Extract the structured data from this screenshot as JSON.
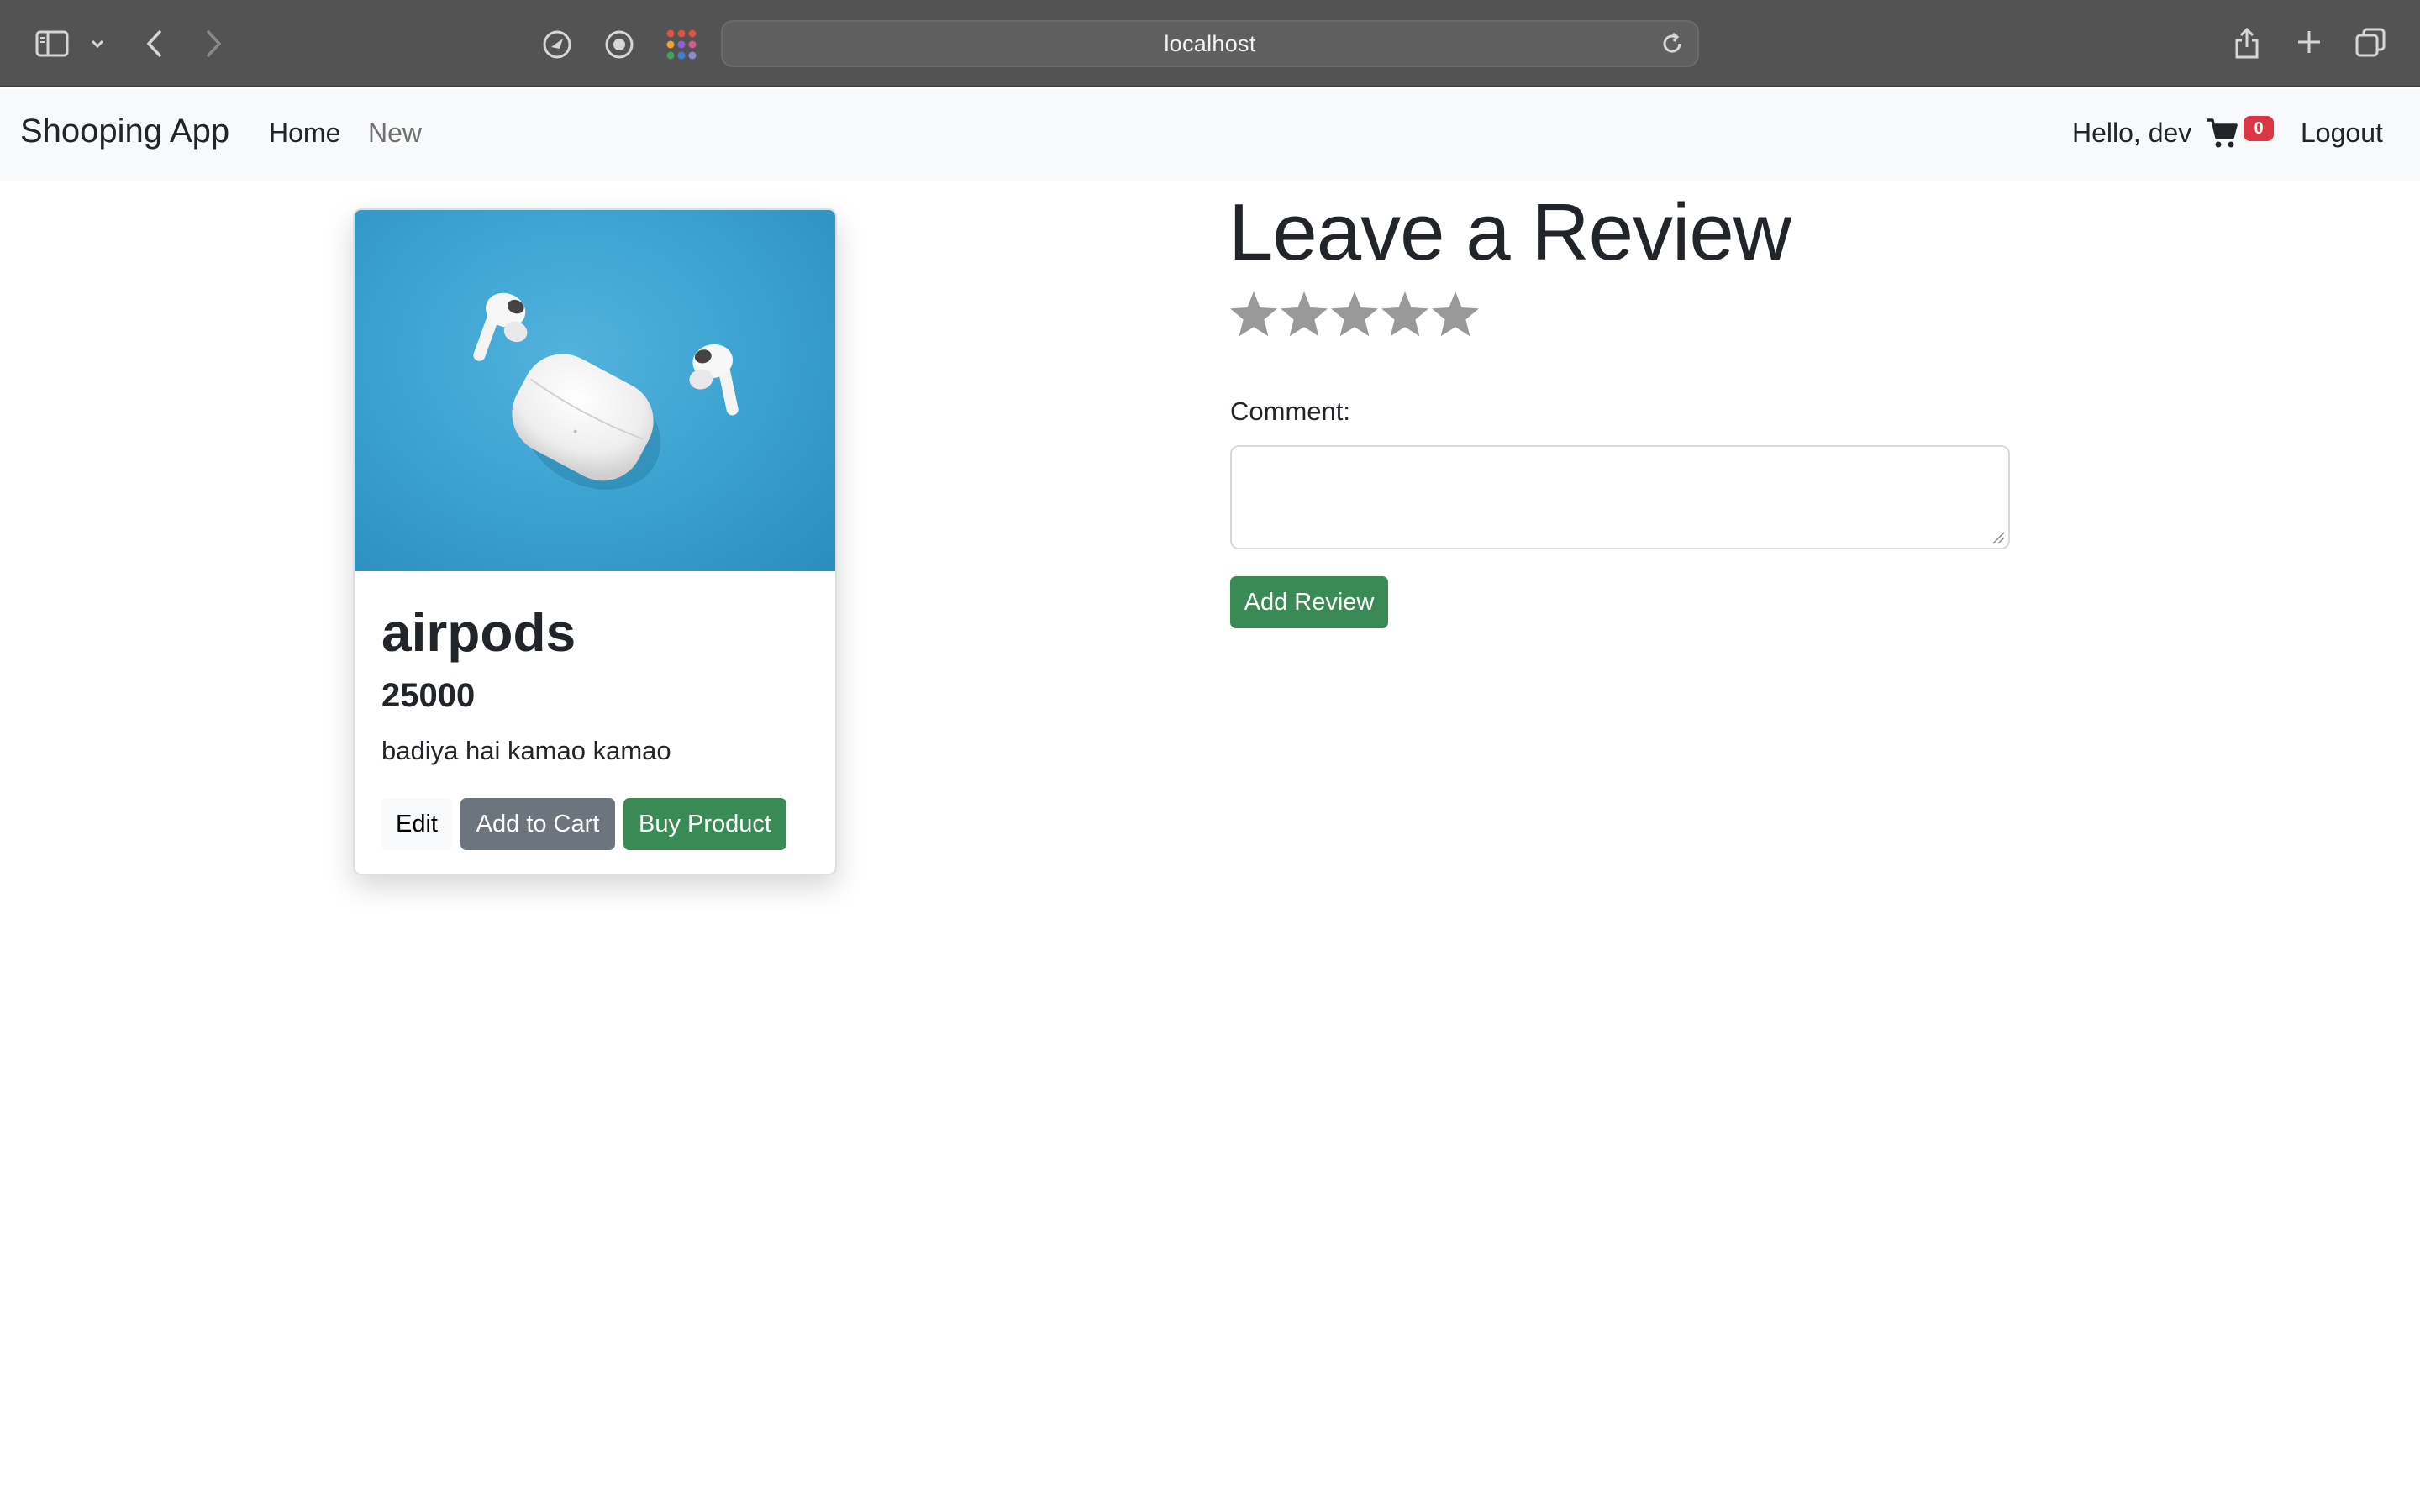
{
  "browser": {
    "address": "localhost",
    "icons": [
      "sidebar-icon",
      "chevron-down-icon",
      "back-icon",
      "forward-icon",
      "privacy-icon",
      "record-icon",
      "apps-grid-icon",
      "reload-icon",
      "share-icon",
      "new-tab-icon",
      "tabs-overview-icon"
    ]
  },
  "navbar": {
    "brand": "Shooping App",
    "links": [
      {
        "label": "Home"
      },
      {
        "label": "New"
      }
    ],
    "greeting": "Hello, dev",
    "cart_count": "0",
    "logout_label": "Logout"
  },
  "product": {
    "name": "airpods",
    "price": "25000",
    "description": "badiya hai kamao kamao",
    "edit_label": "Edit",
    "add_to_cart_label": "Add to Cart",
    "buy_label": "Buy Product"
  },
  "review": {
    "title": "Leave a Review",
    "rating": 0,
    "max_rating": 5,
    "comment_label": "Comment:",
    "comment_value": "",
    "submit_label": "Add Review"
  },
  "colors": {
    "chrome": "#535353",
    "navbar": "#f8f9fa",
    "success": "#3a8a55",
    "secondary": "#6c757d",
    "badge": "#dc3545",
    "star_empty": "#999999"
  }
}
